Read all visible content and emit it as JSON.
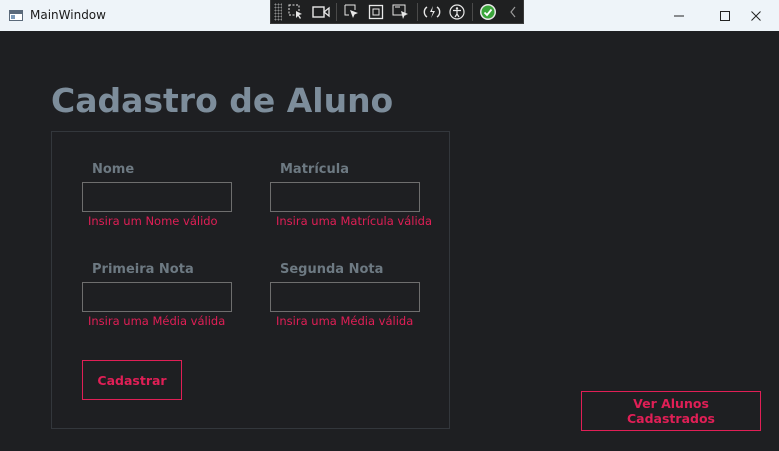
{
  "window": {
    "title": "MainWindow",
    "minimize_glyph": "—",
    "maximize_glyph": "☐",
    "close_glyph": "✕"
  },
  "devtools": {
    "icons": [
      "select-element-icon",
      "display-layout-adorners-icon",
      "track-focus-icon",
      "selection-adorner-icon",
      "preview-selection-icon",
      "hot-reload-icon",
      "accessibility-icon",
      "binding-check-icon",
      "collapse-toolbar-icon"
    ]
  },
  "form": {
    "heading": "Cadastro de Aluno",
    "fields": [
      {
        "label": "Nome",
        "value": "",
        "error": "Insira um Nome válido"
      },
      {
        "label": "Matrícula",
        "value": "",
        "error": "Insira uma Matrícula válida"
      },
      {
        "label": "Primeira Nota",
        "value": "",
        "error": "Insira uma Média válida"
      },
      {
        "label": "Segunda Nota",
        "value": "",
        "error": "Insira uma Média válida"
      }
    ],
    "submit_label": "Cadastrar"
  },
  "list_button_label": "Ver Alunos Cadastrados",
  "colors": {
    "background": "#1e1f22",
    "heading": "#7d8d9b",
    "label": "#6d7982",
    "error": "#e01f56",
    "accent": "#e01f56"
  }
}
